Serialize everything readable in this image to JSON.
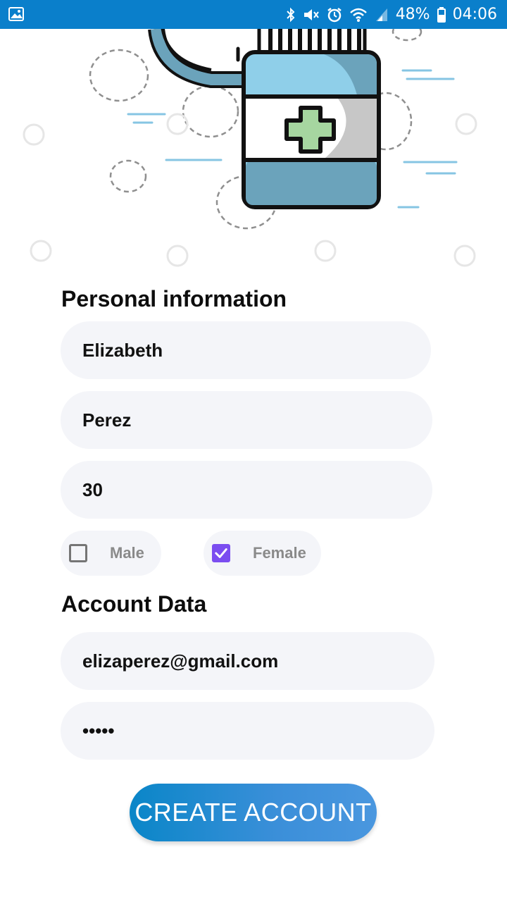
{
  "status_bar": {
    "battery": "48%",
    "time": "04:06"
  },
  "personal": {
    "title": "Personal information",
    "first_name": "Elizabeth",
    "last_name": "Perez",
    "age": "30",
    "gender_options": [
      {
        "label": "Male",
        "checked": false
      },
      {
        "label": "Female",
        "checked": true
      }
    ]
  },
  "account": {
    "title": "Account Data",
    "email": "elizaperez@gmail.com",
    "password_mask": "•••••"
  },
  "actions": {
    "create_account_label": "CREATE ACCOUNT"
  },
  "colors": {
    "status_bar": "#0A7FCB",
    "field_bg": "#F4F5F9",
    "checkbox_accent": "#7B4DF0",
    "button_start": "#0A86C8",
    "button_end": "#4A97DF"
  }
}
